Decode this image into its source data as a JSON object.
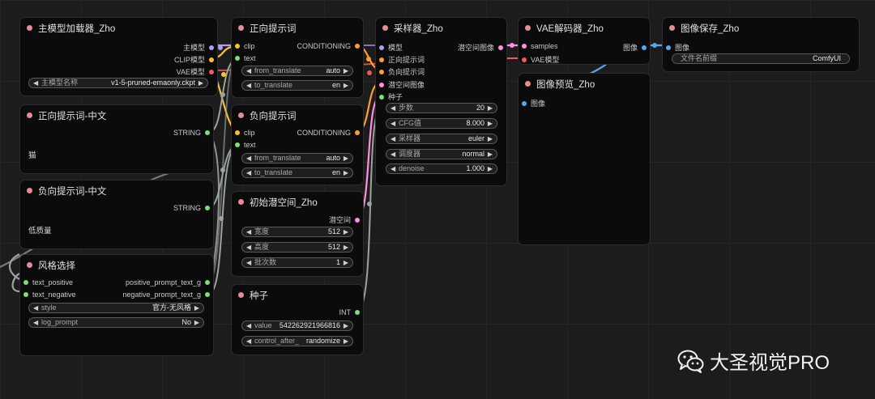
{
  "colors": {
    "canvas": "#1c1c1c",
    "node": "#0b0b0b",
    "title_dot": "#e58c97",
    "model": "#b29cf0",
    "clip": "#ffc02b",
    "vae": "#ee5a55",
    "string": "#78e07c",
    "conditioning": "#ff9e2c",
    "latent": "#ff8fe0",
    "image": "#56a7f3"
  },
  "nodes": {
    "model_loader": {
      "title": "主模型加载器_Zho",
      "out_model": "主模型",
      "out_clip": "CLIP模型",
      "out_vae": "VAE模型",
      "w_name_label": "主模型名称",
      "w_name_value": "v1-5-pruned-emaonly.ckpt"
    },
    "pos_text_cn": {
      "title": "正向提示词-中文",
      "out": "STRING",
      "text": "猫"
    },
    "neg_text_cn": {
      "title": "负向提示词-中文",
      "out": "STRING",
      "text": "低质量"
    },
    "style": {
      "title": "风格选择",
      "in_pos": "text_positive",
      "in_neg": "text_negative",
      "out_pos": "positive_prompt_text_g",
      "out_neg": "negative_prompt_text_g",
      "w_style_label": "style",
      "w_style_value": "官方-无风格",
      "w_log_label": "log_prompt",
      "w_log_value": "No"
    },
    "pos_prompt": {
      "title": "正向提示词",
      "in_clip": "clip",
      "in_text": "text",
      "out": "CONDITIONING",
      "w_from_label": "from_translate",
      "w_from_value": "auto",
      "w_to_label": "to_translate",
      "w_to_value": "en"
    },
    "neg_prompt": {
      "title": "负向提示词",
      "in_clip": "clip",
      "in_text": "text",
      "out": "CONDITIONING",
      "w_from_label": "from_translate",
      "w_from_value": "auto",
      "w_to_label": "to_translate",
      "w_to_value": "en"
    },
    "latent": {
      "title": "初始潜空间_Zho",
      "out": "潜空间",
      "w_width_label": "宽度",
      "w_width_value": "512",
      "w_height_label": "高度",
      "w_height_value": "512",
      "w_batch_label": "批次数",
      "w_batch_value": "1"
    },
    "seed": {
      "title": "种子",
      "out": "INT",
      "w_value_label": "value",
      "w_value_value": "542262921966816",
      "w_ctrl_label": "control_after_",
      "w_ctrl_value": "randomize"
    },
    "sampler": {
      "title": "采样器_Zho",
      "in_model": "模型",
      "in_pos": "正向提示词",
      "in_neg": "负向提示词",
      "in_latent": "潜空间图像",
      "in_seed": "种子",
      "out": "潜空间图像",
      "w_steps_label": "步数",
      "w_steps_value": "20",
      "w_cfg_label": "CFG值",
      "w_cfg_value": "8.000",
      "w_sampler_label": "采样器",
      "w_sampler_value": "euler",
      "w_sched_label": "调度器",
      "w_sched_value": "normal",
      "w_denoise_label": "denoise",
      "w_denoise_value": "1.000"
    },
    "vae_decode": {
      "title": "VAE解码器_Zho",
      "in_samples": "samples",
      "in_vae": "VAE模型",
      "out": "图像"
    },
    "preview": {
      "title": "图像预览_Zho",
      "in_image": "图像"
    },
    "save": {
      "title": "图像保存_Zho",
      "in_image": "图像",
      "w_prefix_label": "文件名前缀",
      "w_prefix_value": "ComfyUI"
    }
  },
  "watermark": {
    "text": "大圣视觉PRO",
    "icon": "wechat-icon"
  }
}
